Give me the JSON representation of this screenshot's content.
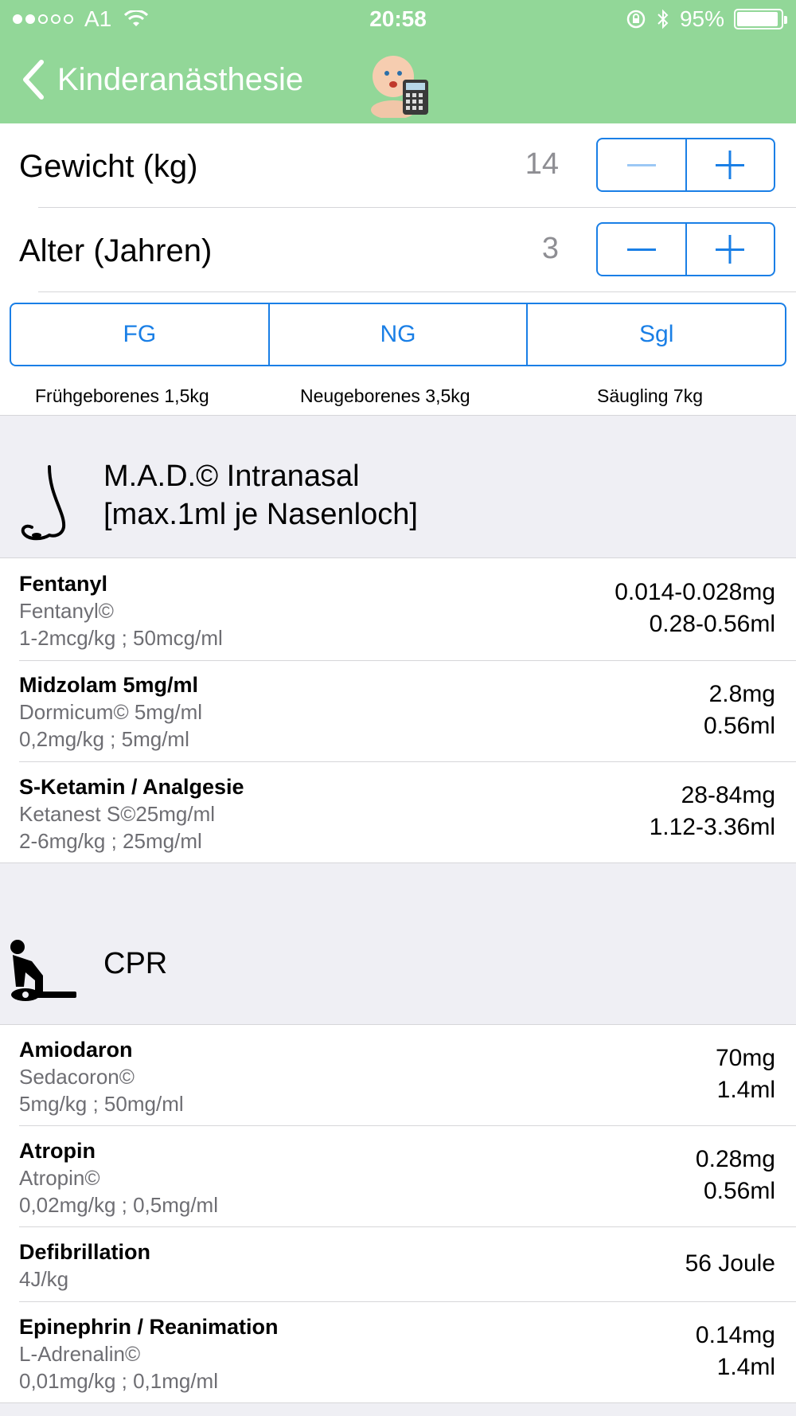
{
  "status_bar": {
    "carrier": "A1",
    "time": "20:58",
    "battery": "95%",
    "battery_level": 0.95,
    "signal_bars_filled": 2,
    "signal_bars_total": 5
  },
  "nav": {
    "back_label": "Kinderanästhesie",
    "icon": "baby-calculator-icon"
  },
  "inputs": {
    "weight_label": "Gewicht (kg)",
    "weight_value": "14",
    "age_label": "Alter (Jahren)",
    "age_value": "3"
  },
  "segmented": {
    "options": [
      "FG",
      "NG",
      "Sgl"
    ],
    "captions": [
      "Frühgeborenes 1,5kg",
      "Neugeborenes 3,5kg",
      "Säugling 7kg"
    ]
  },
  "sections": [
    {
      "icon": "nose-icon",
      "title_line1": "M.A.D.© Intranasal",
      "title_line2": "[max.1ml je Nasenloch]",
      "items": [
        {
          "name": "Fentanyl",
          "brand": "Fentanyl©",
          "dosage": "1-2mcg/kg ; 50mcg/ml",
          "dose_mg": "0.014-0.028mg",
          "dose_ml": "0.28-0.56ml"
        },
        {
          "name": "Midzolam 5mg/ml",
          "brand": "Dormicum© 5mg/ml",
          "dosage": "0,2mg/kg ; 5mg/ml",
          "dose_mg": "2.8mg",
          "dose_ml": "0.56ml"
        },
        {
          "name": "S-Ketamin / Analgesie",
          "brand": "Ketanest S©25mg/ml",
          "dosage": "2-6mg/kg ; 25mg/ml",
          "dose_mg": "28-84mg",
          "dose_ml": "1.12-3.36ml"
        }
      ]
    },
    {
      "icon": "cpr-icon",
      "title": "CPR",
      "items": [
        {
          "name": "Amiodaron",
          "brand": "Sedacoron©",
          "dosage": "5mg/kg ; 50mg/ml",
          "dose_mg": "70mg",
          "dose_ml": "1.4ml"
        },
        {
          "name": "Atropin",
          "brand": "Atropin©",
          "dosage": "0,02mg/kg ; 0,5mg/ml",
          "dose_mg": "0.28mg",
          "dose_ml": "0.56ml"
        },
        {
          "name": "Defibrillation",
          "brand": "4J/kg",
          "dose_single": "56 Joule"
        },
        {
          "name": "Epinephrin / Reanimation",
          "brand": "L-Adrenalin©",
          "dosage": "0,01mg/kg ; 0,1mg/ml",
          "dose_mg": "0.14mg",
          "dose_ml": "1.4ml"
        }
      ]
    }
  ],
  "colors": {
    "nav_bg": "#92d798",
    "accent": "#1a7fe6",
    "section_bg": "#efeff4"
  }
}
